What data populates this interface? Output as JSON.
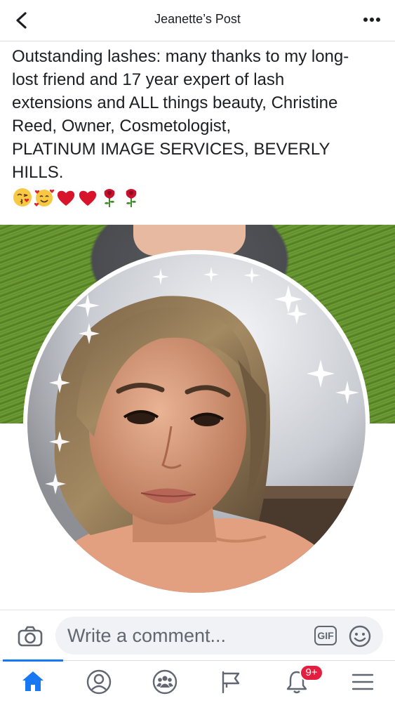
{
  "header": {
    "title": "Jeanette’s Post"
  },
  "post": {
    "text_lines": [
      "Outstanding lashes: many thanks to my long-",
      "lost friend and 17 year expert of lash",
      "extensions and ALL things beauty, Christine",
      "Reed, Owner, Cosmetologist,",
      "PLATINUM IMAGE SERVICES, BEVERLY",
      "HILLS."
    ],
    "emojis": [
      "face-blowing-kiss",
      "smiling-face-with-hearts",
      "red-heart",
      "red-heart",
      "rose",
      "rose"
    ]
  },
  "comment_bar": {
    "placeholder": "Write a comment...",
    "gif_label": "GIF"
  },
  "tabbar": {
    "items": [
      "home",
      "profile",
      "groups",
      "pages",
      "notifications",
      "menu"
    ],
    "active": "home",
    "notifications_badge": "9+"
  },
  "colors": {
    "accent": "#1877f2",
    "badge": "#e41e3f",
    "icon_gray": "#606770"
  }
}
